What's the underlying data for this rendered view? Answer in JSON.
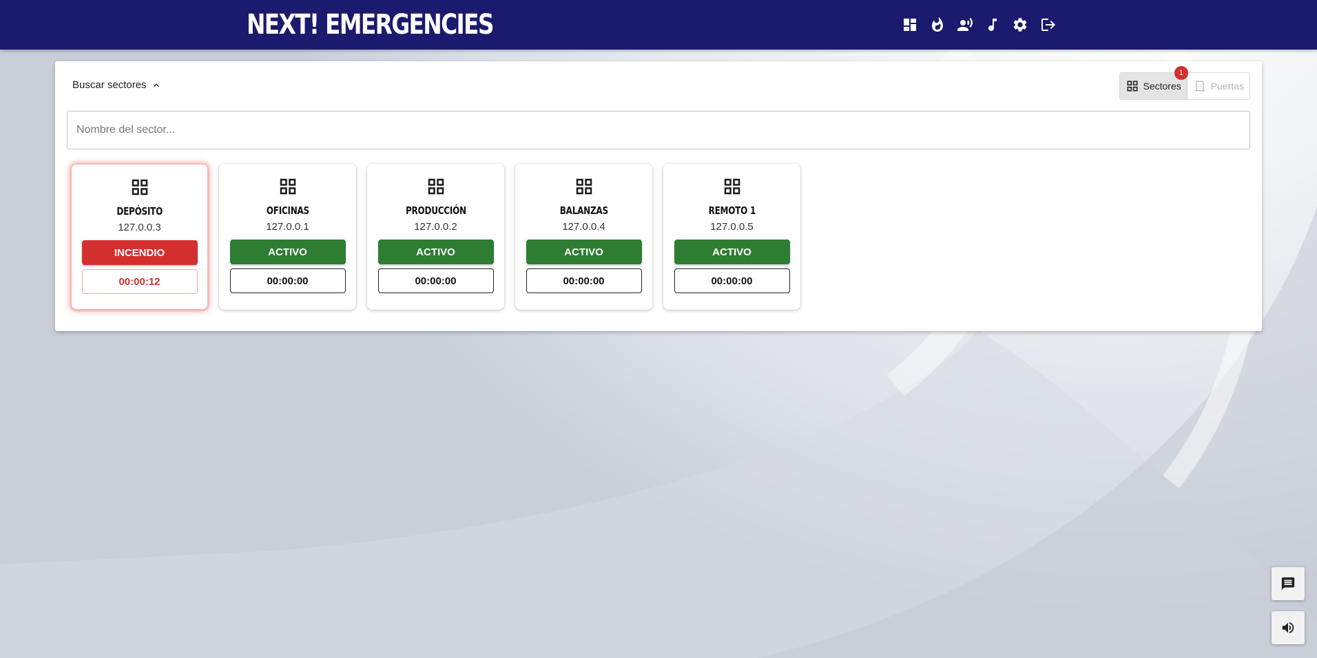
{
  "app": {
    "title": "NEXT! EMERGENCIES"
  },
  "nav": [
    {
      "icon": "dashboard-icon",
      "label": ""
    },
    {
      "icon": "fire-icon",
      "label": ""
    },
    {
      "icon": "speaker-person-icon",
      "label": ""
    },
    {
      "icon": "music-note-icon",
      "label": ""
    },
    {
      "icon": "gear-icon",
      "label": ""
    },
    {
      "icon": "logout-icon",
      "label": ""
    }
  ],
  "search": {
    "toggle_label": "Buscar sectores",
    "placeholder": "Nombre del sector...",
    "value": ""
  },
  "view_toggle": {
    "sectors_label": "Sectores",
    "sectors_badge": "1",
    "doors_label": "Puertas"
  },
  "sectors": [
    {
      "name": "DEPÓSITO",
      "ip": "127.0.0.3",
      "status": "INCENDIO",
      "timer": "00:00:12"
    },
    {
      "name": "OFICINAS",
      "ip": "127.0.0.1",
      "status": "ACTIVO",
      "timer": "00:00:00"
    },
    {
      "name": "PRODUCCIÓN",
      "ip": "127.0.0.2",
      "status": "ACTIVO",
      "timer": "00:00:00"
    },
    {
      "name": "BALANZAS",
      "ip": "127.0.0.4",
      "status": "ACTIVO",
      "timer": "00:00:00"
    },
    {
      "name": "REMOTO 1",
      "ip": "127.0.0.5",
      "status": "ACTIVO",
      "timer": "00:00:00"
    }
  ],
  "colors": {
    "topbar": "#1a1a6e",
    "active": "#2e7d32",
    "alarm": "#d32f2f"
  },
  "fabs": [
    {
      "icon": "message-list-icon"
    },
    {
      "icon": "volume-icon"
    }
  ]
}
